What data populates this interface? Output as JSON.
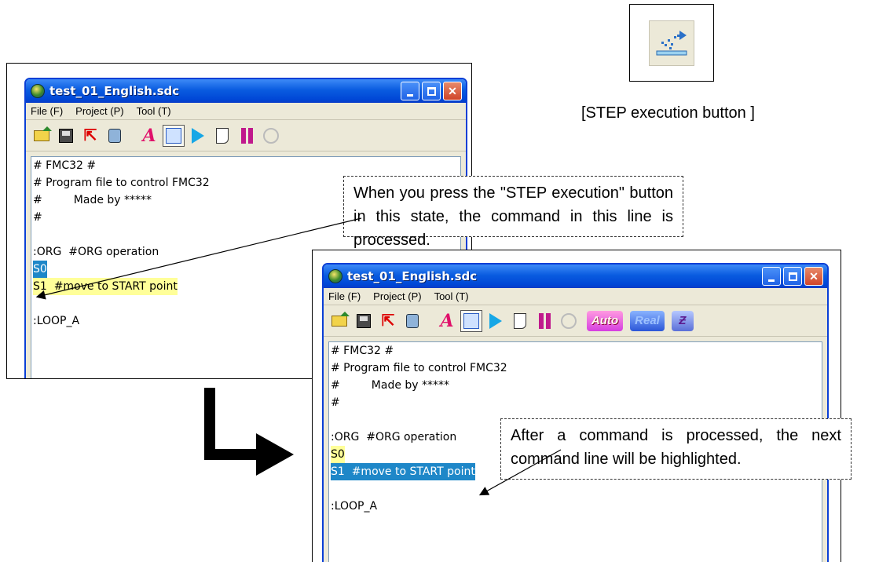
{
  "window": {
    "title": "test_01_English.sdc",
    "menu": [
      "File (F)",
      "Project (P)",
      "Tool (T)"
    ],
    "toolbar_pills": {
      "auto": "Auto",
      "real": "Real",
      "z": "Ƶ"
    }
  },
  "editor_before": {
    "lines": [
      "# FMC32 #",
      "# Program file to control FMC32",
      "#         Made by *****",
      "#",
      "",
      ":ORG  #ORG operation",
      "S0",
      "S1  #move to START point",
      "",
      ":LOOP_A"
    ]
  },
  "editor_after": {
    "lines": [
      "# FMC32 #",
      "# Program file to control FMC32",
      "#         Made by *****",
      "#",
      "",
      ":ORG  #ORG operation",
      "S0",
      "S1  #move to START point",
      "",
      ":LOOP_A"
    ]
  },
  "step_button": {
    "caption": "[STEP execution button ]",
    "icon": "step-execution-icon"
  },
  "callouts": {
    "top": "When you press the \"STEP execution\" button in this state, the command in this line is processed.",
    "bottom": "After a command is processed, the next command line will be highlighted."
  },
  "colors": {
    "titlebar": "#0a5ce0",
    "current_line_highlight": "#1e87c8",
    "next_line_highlight": "#ffff99"
  }
}
